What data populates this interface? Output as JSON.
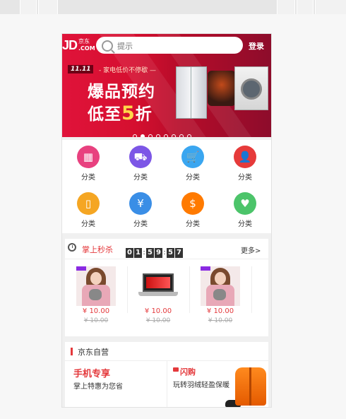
{
  "header": {
    "logo_jd": "JD",
    "logo_cn": "京东",
    "logo_com": ".COM",
    "search_placeholder": "提示",
    "login_label": "登录"
  },
  "banner": {
    "tag": "11.11",
    "sub": "- 家电低价不停歇 —",
    "line1": "爆品预约",
    "line2_pre": "低至",
    "line2_big": "5",
    "line2_post": "折",
    "slide_count": 8,
    "active_slide": 2
  },
  "categories": [
    {
      "label": "分类",
      "icon": "grid-icon",
      "color": "#e8417f",
      "glyph": "▦"
    },
    {
      "label": "分类",
      "icon": "truck-icon",
      "color": "#7c56e6",
      "glyph": "⛟"
    },
    {
      "label": "分类",
      "icon": "cart-icon",
      "color": "#3aa6f0",
      "glyph": "🛒"
    },
    {
      "label": "分类",
      "icon": "user-icon",
      "color": "#e63a3a",
      "glyph": "👤"
    },
    {
      "label": "分类",
      "icon": "phone-recharge-icon",
      "color": "#f5a623",
      "glyph": "▯"
    },
    {
      "label": "分类",
      "icon": "ticket-icon",
      "color": "#3a8ee6",
      "glyph": "¥"
    },
    {
      "label": "分类",
      "icon": "coupon-icon",
      "color": "#ff7a00",
      "glyph": "$"
    },
    {
      "label": "分类",
      "icon": "heart-icon",
      "color": "#4cc46a",
      "glyph": "♥"
    }
  ],
  "flash": {
    "title": "掌上秒杀",
    "timer": [
      "0",
      "1",
      ":",
      "5",
      "9",
      ":",
      "5",
      "7"
    ],
    "more": "更多>",
    "items": [
      {
        "kind": "girl",
        "price": "¥ 10.00",
        "old": "¥ 10.00"
      },
      {
        "kind": "laptop",
        "price": "¥ 10.00",
        "old": "¥ 10.00"
      },
      {
        "kind": "girl",
        "price": "¥ 10.00",
        "old": "¥ 10.00"
      }
    ]
  },
  "selfrun": {
    "title": "京东自营",
    "left_title": "手机专享",
    "left_sub": "掌上特惠为您省",
    "right_title": "闪购",
    "right_sub": "玩转羽绒轻盈保暖"
  },
  "colors": {
    "accent": "#e4393c",
    "banner": "#d50f2f"
  }
}
